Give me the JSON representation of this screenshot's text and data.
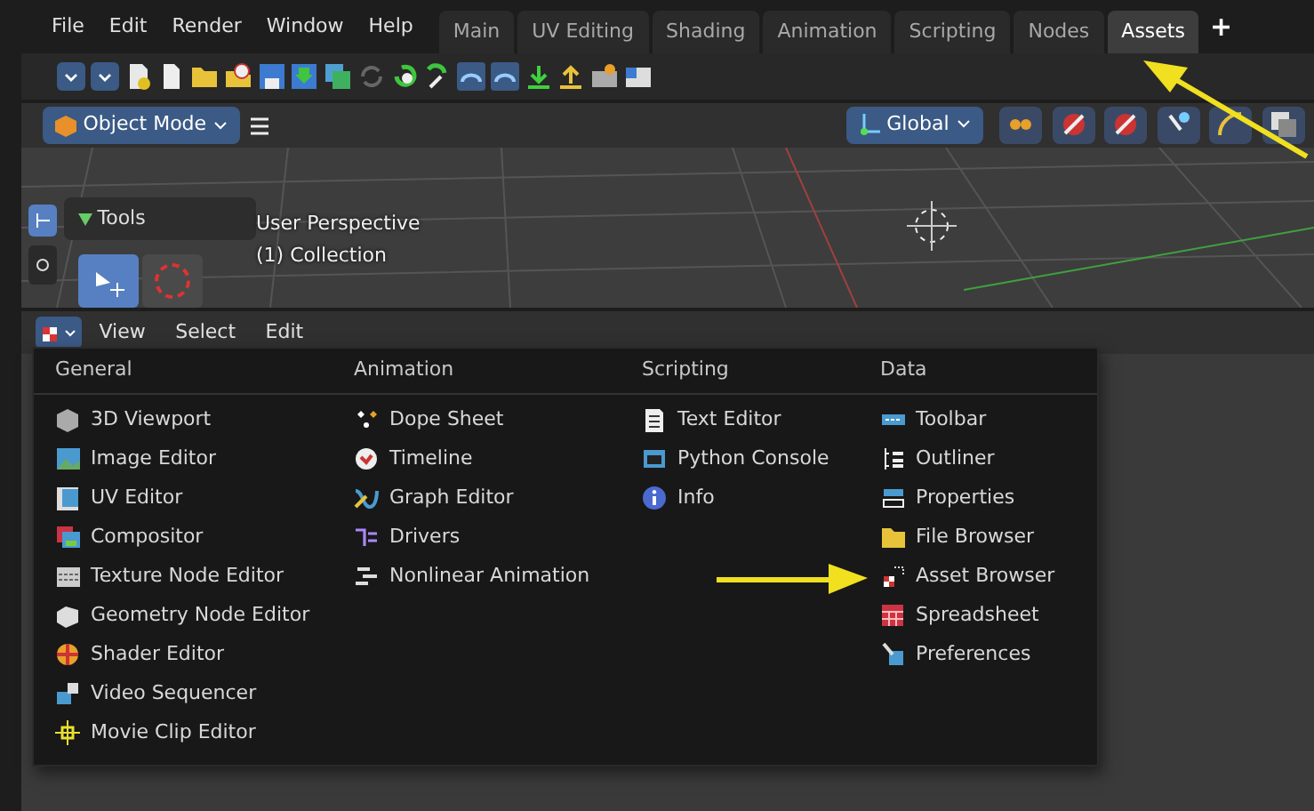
{
  "menubar": [
    "File",
    "Edit",
    "Render",
    "Window",
    "Help"
  ],
  "workspace_tabs": [
    {
      "label": "Main",
      "selected": false
    },
    {
      "label": "UV Editing",
      "selected": false
    },
    {
      "label": "Shading",
      "selected": false
    },
    {
      "label": "Animation",
      "selected": false
    },
    {
      "label": "Scripting",
      "selected": false
    },
    {
      "label": "Nodes",
      "selected": false
    },
    {
      "label": "Assets",
      "selected": true
    }
  ],
  "add_workspace": "+",
  "view3d_header": {
    "mode": "Object Mode",
    "orientation": "Global"
  },
  "viewport": {
    "panel_title": "Tools",
    "view_name": "User Perspective",
    "collection": "(1) Collection"
  },
  "editor_menu": [
    "View",
    "Select",
    "Edit"
  ],
  "editor_type_menu": [
    {
      "heading": "General",
      "items": [
        "3D Viewport",
        "Image Editor",
        "UV Editor",
        "Compositor",
        "Texture Node Editor",
        "Geometry Node Editor",
        "Shader Editor",
        "Video Sequencer",
        "Movie Clip Editor"
      ]
    },
    {
      "heading": "Animation",
      "items": [
        "Dope Sheet",
        "Timeline",
        "Graph Editor",
        "Drivers",
        "Nonlinear Animation"
      ]
    },
    {
      "heading": "Scripting",
      "items": [
        "Text Editor",
        "Python Console",
        "Info"
      ]
    },
    {
      "heading": "Data",
      "items": [
        "Toolbar",
        "Outliner",
        "Properties",
        "File Browser",
        "Asset Browser",
        "Spreadsheet",
        "Preferences"
      ]
    }
  ]
}
